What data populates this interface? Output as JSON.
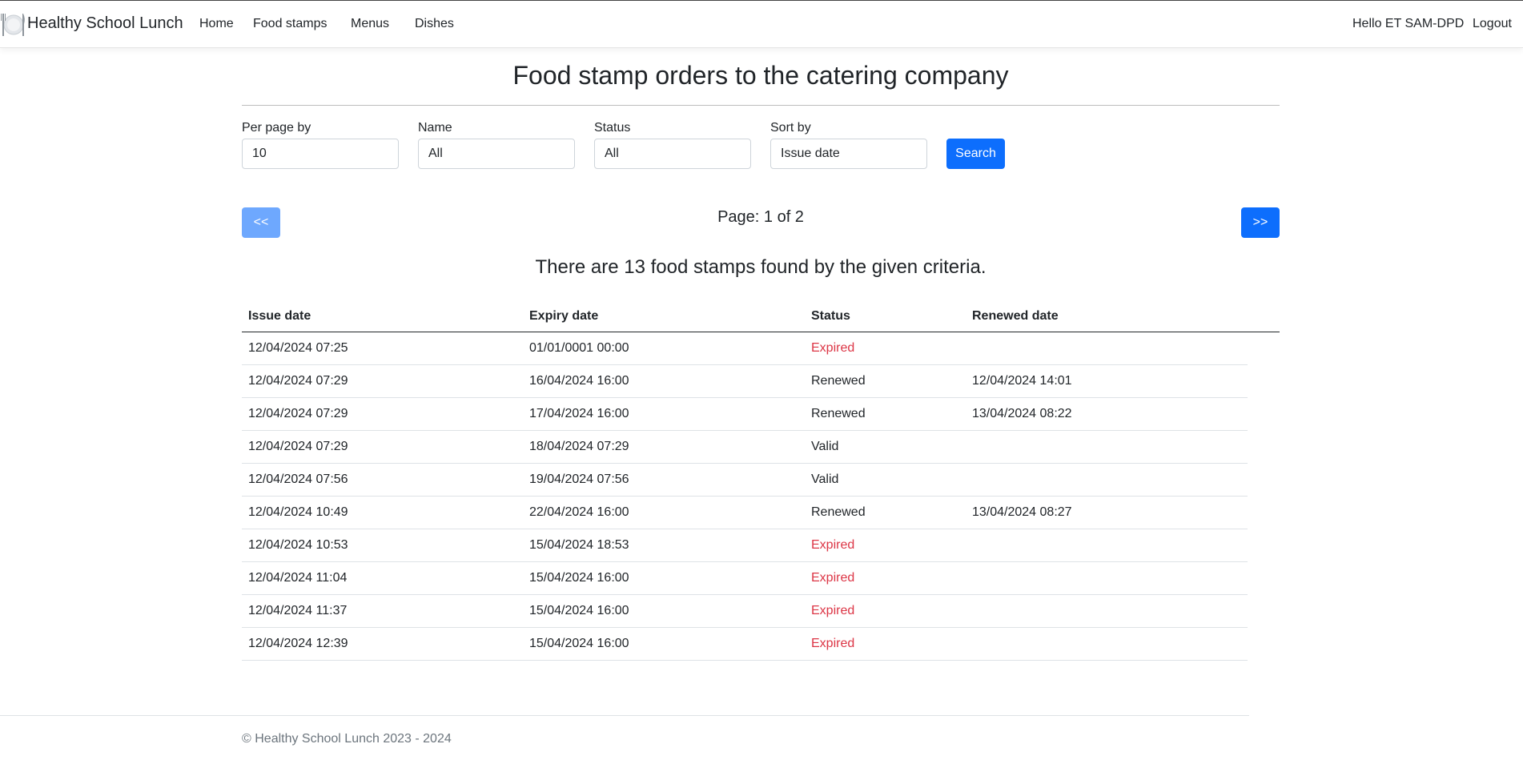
{
  "app": {
    "brand": "Healthy School Lunch"
  },
  "nav": {
    "items": [
      {
        "label": "Home"
      },
      {
        "label": "Food stamps"
      },
      {
        "label": "Menus"
      },
      {
        "label": "Dishes"
      }
    ],
    "user_greeting": "Hello ET SAM-DPD",
    "logout_label": "Logout"
  },
  "page": {
    "title": "Food stamp orders to the catering company"
  },
  "filters": {
    "per_page": {
      "label": "Per page by",
      "value": "10"
    },
    "name": {
      "label": "Name",
      "value": "All"
    },
    "status": {
      "label": "Status",
      "value": "All"
    },
    "sort_by": {
      "label": "Sort by",
      "value": "Issue date"
    },
    "search_label": "Search"
  },
  "pagination": {
    "prev_label": "<<",
    "next_label": ">>",
    "page_info": "Page: 1 of 2",
    "prev_disabled": true
  },
  "results": {
    "summary": "There are 13 food stamps found by the given criteria."
  },
  "table": {
    "columns": [
      "Issue date",
      "Expiry date",
      "Status",
      "Renewed date"
    ],
    "rows": [
      {
        "issue_date": "12/04/2024 07:25",
        "expiry_date": "01/01/0001 00:00",
        "status": "Expired",
        "renewed_date": ""
      },
      {
        "issue_date": "12/04/2024 07:29",
        "expiry_date": "16/04/2024 16:00",
        "status": "Renewed",
        "renewed_date": "12/04/2024 14:01"
      },
      {
        "issue_date": "12/04/2024 07:29",
        "expiry_date": "17/04/2024 16:00",
        "status": "Renewed",
        "renewed_date": "13/04/2024 08:22"
      },
      {
        "issue_date": "12/04/2024 07:29",
        "expiry_date": "18/04/2024 07:29",
        "status": "Valid",
        "renewed_date": ""
      },
      {
        "issue_date": "12/04/2024 07:56",
        "expiry_date": "19/04/2024 07:56",
        "status": "Valid",
        "renewed_date": ""
      },
      {
        "issue_date": "12/04/2024 10:49",
        "expiry_date": "22/04/2024 16:00",
        "status": "Renewed",
        "renewed_date": "13/04/2024 08:27"
      },
      {
        "issue_date": "12/04/2024 10:53",
        "expiry_date": "15/04/2024 18:53",
        "status": "Expired",
        "renewed_date": ""
      },
      {
        "issue_date": "12/04/2024 11:04",
        "expiry_date": "15/04/2024 16:00",
        "status": "Expired",
        "renewed_date": ""
      },
      {
        "issue_date": "12/04/2024 11:37",
        "expiry_date": "15/04/2024 16:00",
        "status": "Expired",
        "renewed_date": ""
      },
      {
        "issue_date": "12/04/2024 12:39",
        "expiry_date": "15/04/2024 16:00",
        "status": "Expired",
        "renewed_date": ""
      }
    ]
  },
  "footer": {
    "text": "© Healthy School Lunch 2023 - 2024"
  },
  "colors": {
    "primary": "#0d6efd",
    "primary_disabled": "#6ea8fe",
    "expired": "#dc3545",
    "text": "#212529",
    "muted": "#6c757d"
  },
  "icons": {
    "brand": "plate-fork-knife-icon"
  }
}
